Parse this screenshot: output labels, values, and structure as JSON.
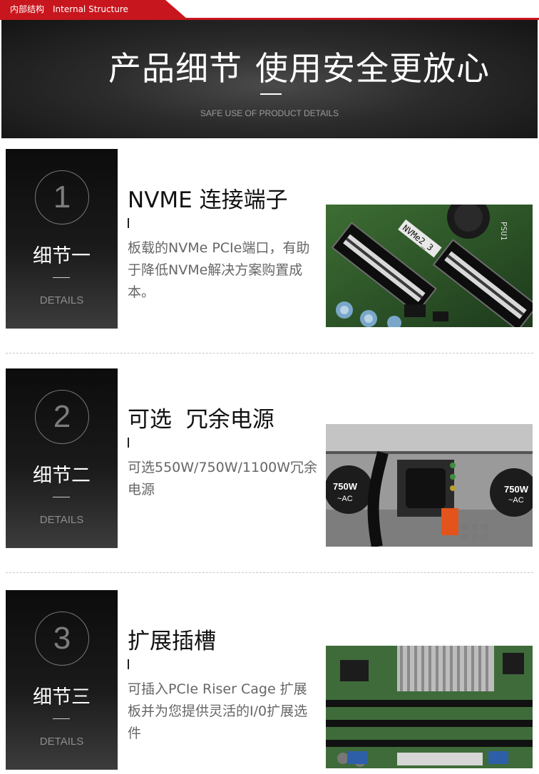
{
  "header": {
    "tag_cn": "内部结构",
    "tag_en": "Internal Structure"
  },
  "hero": {
    "title_a": "产品细节",
    "title_b": "使用安全更放心",
    "subtitle": "SAFE USE OF PRODUCT DETAILS"
  },
  "details": [
    {
      "number": "1",
      "label": "细节一",
      "sublabel": "DETAILS",
      "title": "NVME 连接端子",
      "bar": "I",
      "description": "板载的NVMe PCIe端口，有助于降低NVMe解决方案购置成本。",
      "photo_text": [
        "NVMe2_3",
        "PSU1"
      ]
    },
    {
      "number": "2",
      "label": "细节二",
      "sublabel": "DETAILS",
      "title": "可选  冗余电源",
      "bar": "I",
      "description": "可选550W/750W/1100W冗余电源",
      "photo_text": [
        "750W",
        "~AC",
        "750W",
        "~AC"
      ]
    },
    {
      "number": "3",
      "label": "细节三",
      "sublabel": "DETAILS",
      "title": "扩展插槽",
      "bar": "I",
      "description": "可插入PCIe Riser Cage 扩展板并为您提供灵活的I/0扩展选件",
      "photo_text": []
    }
  ],
  "colors": {
    "accent_red": "#c8161e",
    "badge_dark": "#111111",
    "text_dark": "#111111",
    "text_gray": "#666666"
  }
}
